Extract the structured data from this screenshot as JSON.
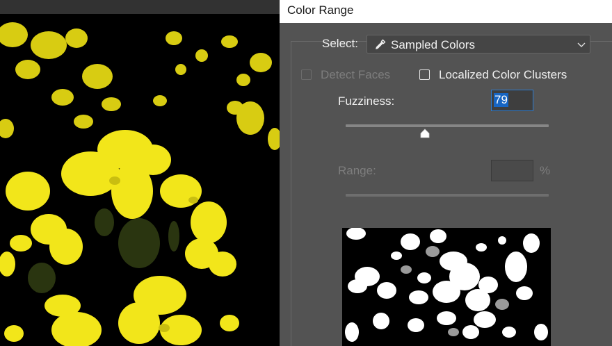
{
  "dialog": {
    "title": "Color Range",
    "select_label": "Select:",
    "select_value": "Sampled Colors",
    "detect_faces_label": "Detect Faces",
    "localized_clusters_label": "Localized Color Clusters",
    "fuzziness_label": "Fuzziness:",
    "fuzziness_value": "79",
    "fuzziness_level": 0.79,
    "range_label": "Range:",
    "range_value": "",
    "range_unit": "%",
    "detect_faces_checked": false,
    "localized_clusters_checked": false
  },
  "icons": {
    "eyedropper": "eyedropper-icon",
    "dropdown": "chevron-down-icon"
  },
  "colors": {
    "dialog_bg": "#535353",
    "flower_yellow": "#f2e61a",
    "selection_blue": "#1765c2"
  }
}
